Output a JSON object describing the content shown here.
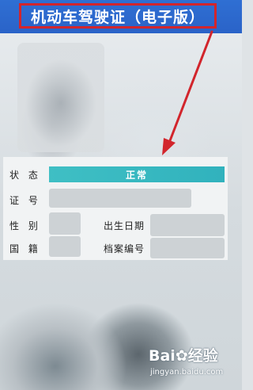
{
  "header": {
    "title": "机动车驾驶证（电子版）"
  },
  "info": {
    "status_label": "状 态",
    "status_value": "正常",
    "id_label": "证 号",
    "gender_label": "性 别",
    "birth_label": "出生日期",
    "nation_label": "国 籍",
    "file_label": "档案编号"
  },
  "watermark": {
    "brand": "Bai",
    "brand_tail": "经验",
    "url": "jingyan.baidu.com"
  },
  "colors": {
    "header": "#2a63c8",
    "highlight": "#d2252c",
    "status": "#31b2bd"
  }
}
